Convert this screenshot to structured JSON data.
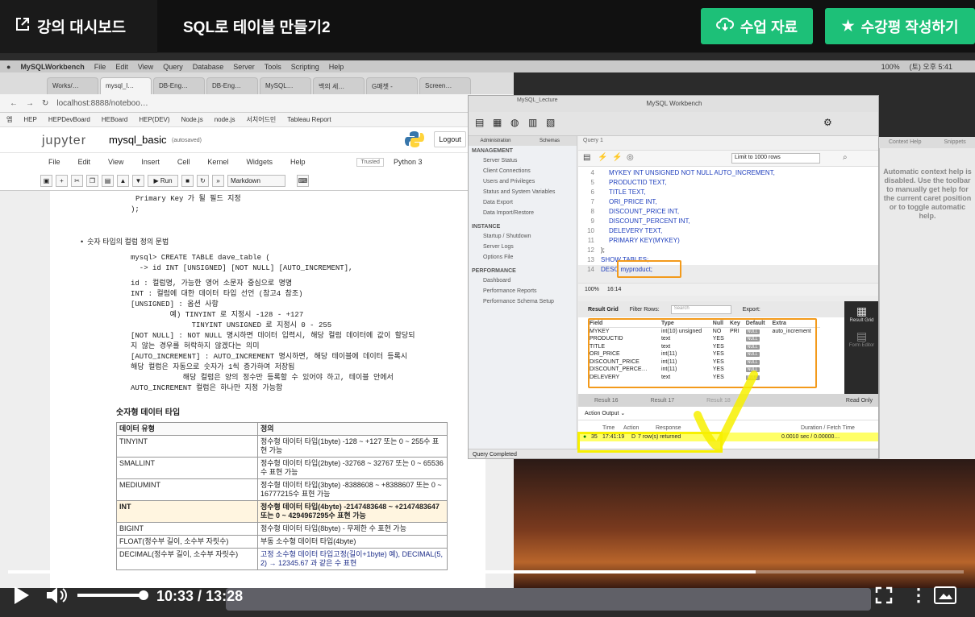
{
  "header": {
    "back_label": "강의 대시보드",
    "title": "SQL로 테이블 만들기2",
    "materials_label": "수업 자료",
    "review_label": "수강평 작성하기",
    "accent_color": "#1dc078"
  },
  "mac_menubar": {
    "items": [
      "MySQLWorkbench",
      "File",
      "Edit",
      "View",
      "Query",
      "Database",
      "Server",
      "Tools",
      "Scripting",
      "Help"
    ],
    "battery": "100%",
    "clock": "(토) 오후 5:41"
  },
  "browser": {
    "tabs": [
      "Works/…",
      "mysql_l…",
      "DB-Eng…",
      "DB-Eng…",
      "MySQL…",
      "백의 세…",
      "G매쳇 -",
      "Screen…"
    ],
    "url": "localhost:8888/noteboo…",
    "bookmarks": [
      "앱",
      "HEP",
      "HEPDevBoard",
      "HEBoard",
      "HEP(DEV)",
      "Node.js",
      "node.js",
      "서치어드민",
      "Tableau Report"
    ]
  },
  "jupyter": {
    "brand": "jupyter",
    "notebook_name": "mysql_basic",
    "autosaved": "(autosaved)",
    "logout": "Logout",
    "trusted": "Trusted",
    "kernel": "Python 3",
    "menu": [
      "File",
      "Edit",
      "View",
      "Insert",
      "Cell",
      "Kernel",
      "Widgets",
      "Help"
    ],
    "run_label": "Run",
    "cell_type": "Markdown",
    "content": {
      "pk_line": "Primary Key 가 될 필드 지정",
      "close_line": ");",
      "bullet": "숫자 타입의 컬럼 정의 문법",
      "syntax_1": "mysql> CREATE TABLE dave_table (",
      "syntax_2": "  -> id INT [UNSIGNED] [NOT NULL] [AUTO_INCREMENT],",
      "desc_1": "id : 컬럼명, 가능한 영어 소문자 중심으로 명명",
      "desc_2": "INT : 컬럼에 대한 데이터 타입 선언 (참고4 참조)",
      "desc_3": "[UNSIGNED] : 옵션 사항",
      "desc_4": "         예) TINYINT 로 지정시 -128 - +127",
      "desc_5": "              TINYINT UNSIGNED 로 지정시 0 - 255",
      "desc_6": "[NOT NULL] : NOT NULL 명시하면 데이터 입력시, 해당 컬럼 데이터에 값이 할당되",
      "desc_7": "지 않는 경우를 허락하지 않겠다는 의미",
      "desc_8": "[AUTO_INCREMENT] : AUTO_INCREMENT 명시하면, 해당 테이블에 데이터 등록시",
      "desc_9": "해당 컬럼은 자동으로 숫자가 1씩 증가하여 저장됨",
      "desc_10": "            해당 컬럼은 양의 정수만 등록할 수 있어야 하고, 테이블 안에서",
      "desc_11": "AUTO_INCREMENT 컬럼은 하나만 지정 가능함",
      "table_title": "숫자형 데이터 타입",
      "table_headers": [
        "데이터 유형",
        "정의"
      ],
      "table_rows": [
        [
          "TINYINT",
          "정수형 데이터 타입(1byte) -128 ~ +127 또는 0 ~ 255수 표현 가능"
        ],
        [
          "SMALLINT",
          "정수형 데이터 타입(2byte) -32768 ~ 32767 또는 0 ~ 65536수 표현 가능"
        ],
        [
          "MEDIUMINT",
          "정수형 데이터 타입(3byte) -8388608 ~ +8388607 또는 0 ~ 16777215수 표현 가능"
        ],
        [
          "INT",
          "정수형 데이터 타입(4byte) -2147483648 ~ +2147483647 또는 0 ~ 4294967295수 표현 가능"
        ],
        [
          "BIGINT",
          "정수형 데이터 타입(8byte) - 무제한 수 표현 가능"
        ],
        [
          "FLOAT(정수부 길이, 소수부 자릿수)",
          "부동 소수형 데이터 타입(4byte)"
        ],
        [
          "DECIMAL(정수부 길이, 소수부 자릿수)",
          "고정 소수형 데이터 타입고정(길이+1byte) 예), DECIMAL(5, 2) → 12345.67 과 같은 수 표현"
        ]
      ]
    }
  },
  "workbench": {
    "title": "MySQL Workbench",
    "connection_tab": "MySQL_Lecture",
    "side_tabs": [
      "Administration",
      "Schemas"
    ],
    "query_tab": "Query 1",
    "limit_select": "Limit to 1000 rows",
    "sidebar": {
      "management": "MANAGEMENT",
      "management_items": [
        "Server Status",
        "Client Connections",
        "Users and Privileges",
        "Status and System Variables",
        "Data Export",
        "Data Import/Restore"
      ],
      "instance": "INSTANCE",
      "instance_items": [
        "Startup / Shutdown",
        "Server Logs",
        "Options File"
      ],
      "performance": "PERFORMANCE",
      "performance_items": [
        "Dashboard",
        "Performance Reports",
        "Performance Schema Setup"
      ]
    },
    "code_lines": [
      {
        "n": "4",
        "t": "MYKEY INT UNSIGNED NOT NULL AUTO_INCREMENT,"
      },
      {
        "n": "5",
        "t": "PRODUCTID TEXT,"
      },
      {
        "n": "6",
        "t": "TITLE TEXT,"
      },
      {
        "n": "7",
        "t": "ORI_PRICE INT,"
      },
      {
        "n": "8",
        "t": "DISCOUNT_PRICE INT,"
      },
      {
        "n": "9",
        "t": "DISCOUNT_PERCENT INT,"
      },
      {
        "n": "10",
        "t": "DELEVERY TEXT,"
      },
      {
        "n": "11",
        "t": "PRIMARY KEY(MYKEY)"
      },
      {
        "n": "12",
        "t": ");"
      },
      {
        "n": "13",
        "t": "SHOW TABLES;"
      },
      {
        "n": "14",
        "t": "DESC myproduct;"
      }
    ],
    "zoom": "100%",
    "cursor_pos": "16:14",
    "result_grid_label": "Result Grid",
    "filter_label": "Filter Rows:",
    "search_placeholder": "Search",
    "export_label": "Export:",
    "result_headers": [
      "Field",
      "Type",
      "Null",
      "Key",
      "Default",
      "Extra"
    ],
    "result_rows": [
      [
        "MYKEY",
        "int(10) unsigned",
        "NO",
        "PRI",
        "NULL",
        "auto_increment"
      ],
      [
        "PRODUCTID",
        "text",
        "YES",
        "",
        "NULL",
        ""
      ],
      [
        "TITLE",
        "text",
        "YES",
        "",
        "NULL",
        ""
      ],
      [
        "ORI_PRICE",
        "int(11)",
        "YES",
        "",
        "NULL",
        ""
      ],
      [
        "DISCOUNT_PRICE",
        "int(11)",
        "YES",
        "",
        "NULL",
        ""
      ],
      [
        "DISCOUNT_PERCE…",
        "int(11)",
        "YES",
        "",
        "NULL",
        ""
      ],
      [
        "DELEVERY",
        "text",
        "YES",
        "",
        "NULL",
        ""
      ]
    ],
    "result_side": [
      "Result Grid",
      "Form Editor"
    ],
    "result_tabs": [
      "Result 16",
      "Result 17",
      "Result 18"
    ],
    "read_only": "Read Only",
    "action_output": "Action Output",
    "output_headers": [
      "Time",
      "Action",
      "Response",
      "Duration / Fetch Time"
    ],
    "output_row": {
      "num": "35",
      "time": "17:41:19",
      "action": "D",
      "response": "7 row(s) returned",
      "duration": "0.0010 sec / 0.00000…"
    },
    "status": "Query Completed",
    "context_header": [
      "Context Help",
      "Snippets"
    ],
    "context_text": "Automatic context help is disabled. Use the toolbar to manually get help for the current caret position or to toggle automatic help."
  },
  "player": {
    "current_time": "10:33",
    "duration": "13:28",
    "progress": 0.782,
    "volume": 0.95
  }
}
